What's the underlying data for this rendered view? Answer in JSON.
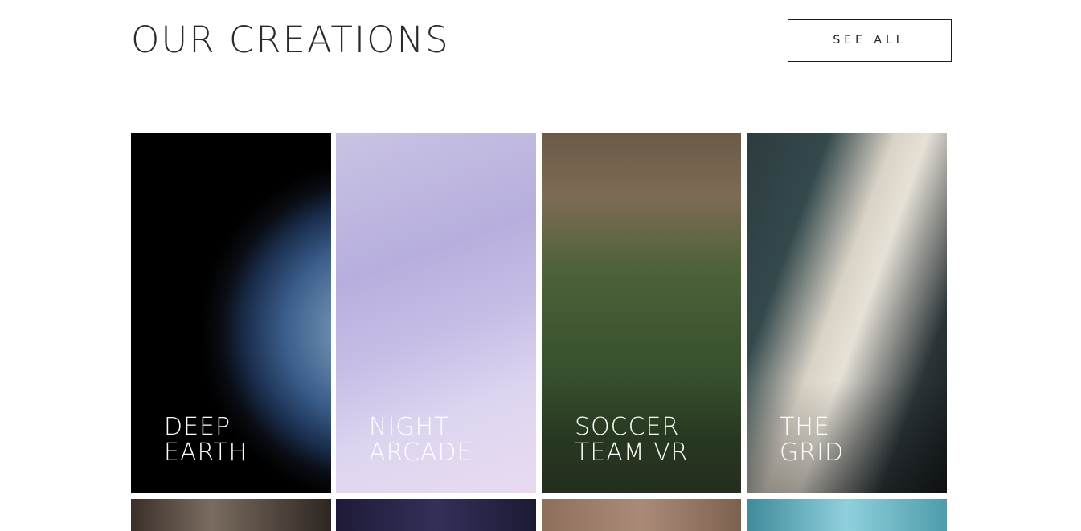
{
  "header": {
    "title": "OUR CREATIONS",
    "see_all_label": "SEE ALL"
  },
  "creations": [
    {
      "line1": "DEEP",
      "line2": "EARTH",
      "image": "earth-from-space"
    },
    {
      "line1": "NIGHT",
      "line2": "ARCADE",
      "image": "skee-ball-arcade"
    },
    {
      "line1": "SOCCER",
      "line2": "TEAM VR",
      "image": "soccer-player"
    },
    {
      "line1": "THE",
      "line2": "GRID",
      "image": "race-car"
    }
  ],
  "second_row_images": [
    "highway-aerial",
    "starry-sky",
    "desert-car",
    "sky-fisheye"
  ],
  "colors": {
    "background": "#ffffff",
    "text": "#2b2b2b",
    "card_label": "#ffffff"
  }
}
